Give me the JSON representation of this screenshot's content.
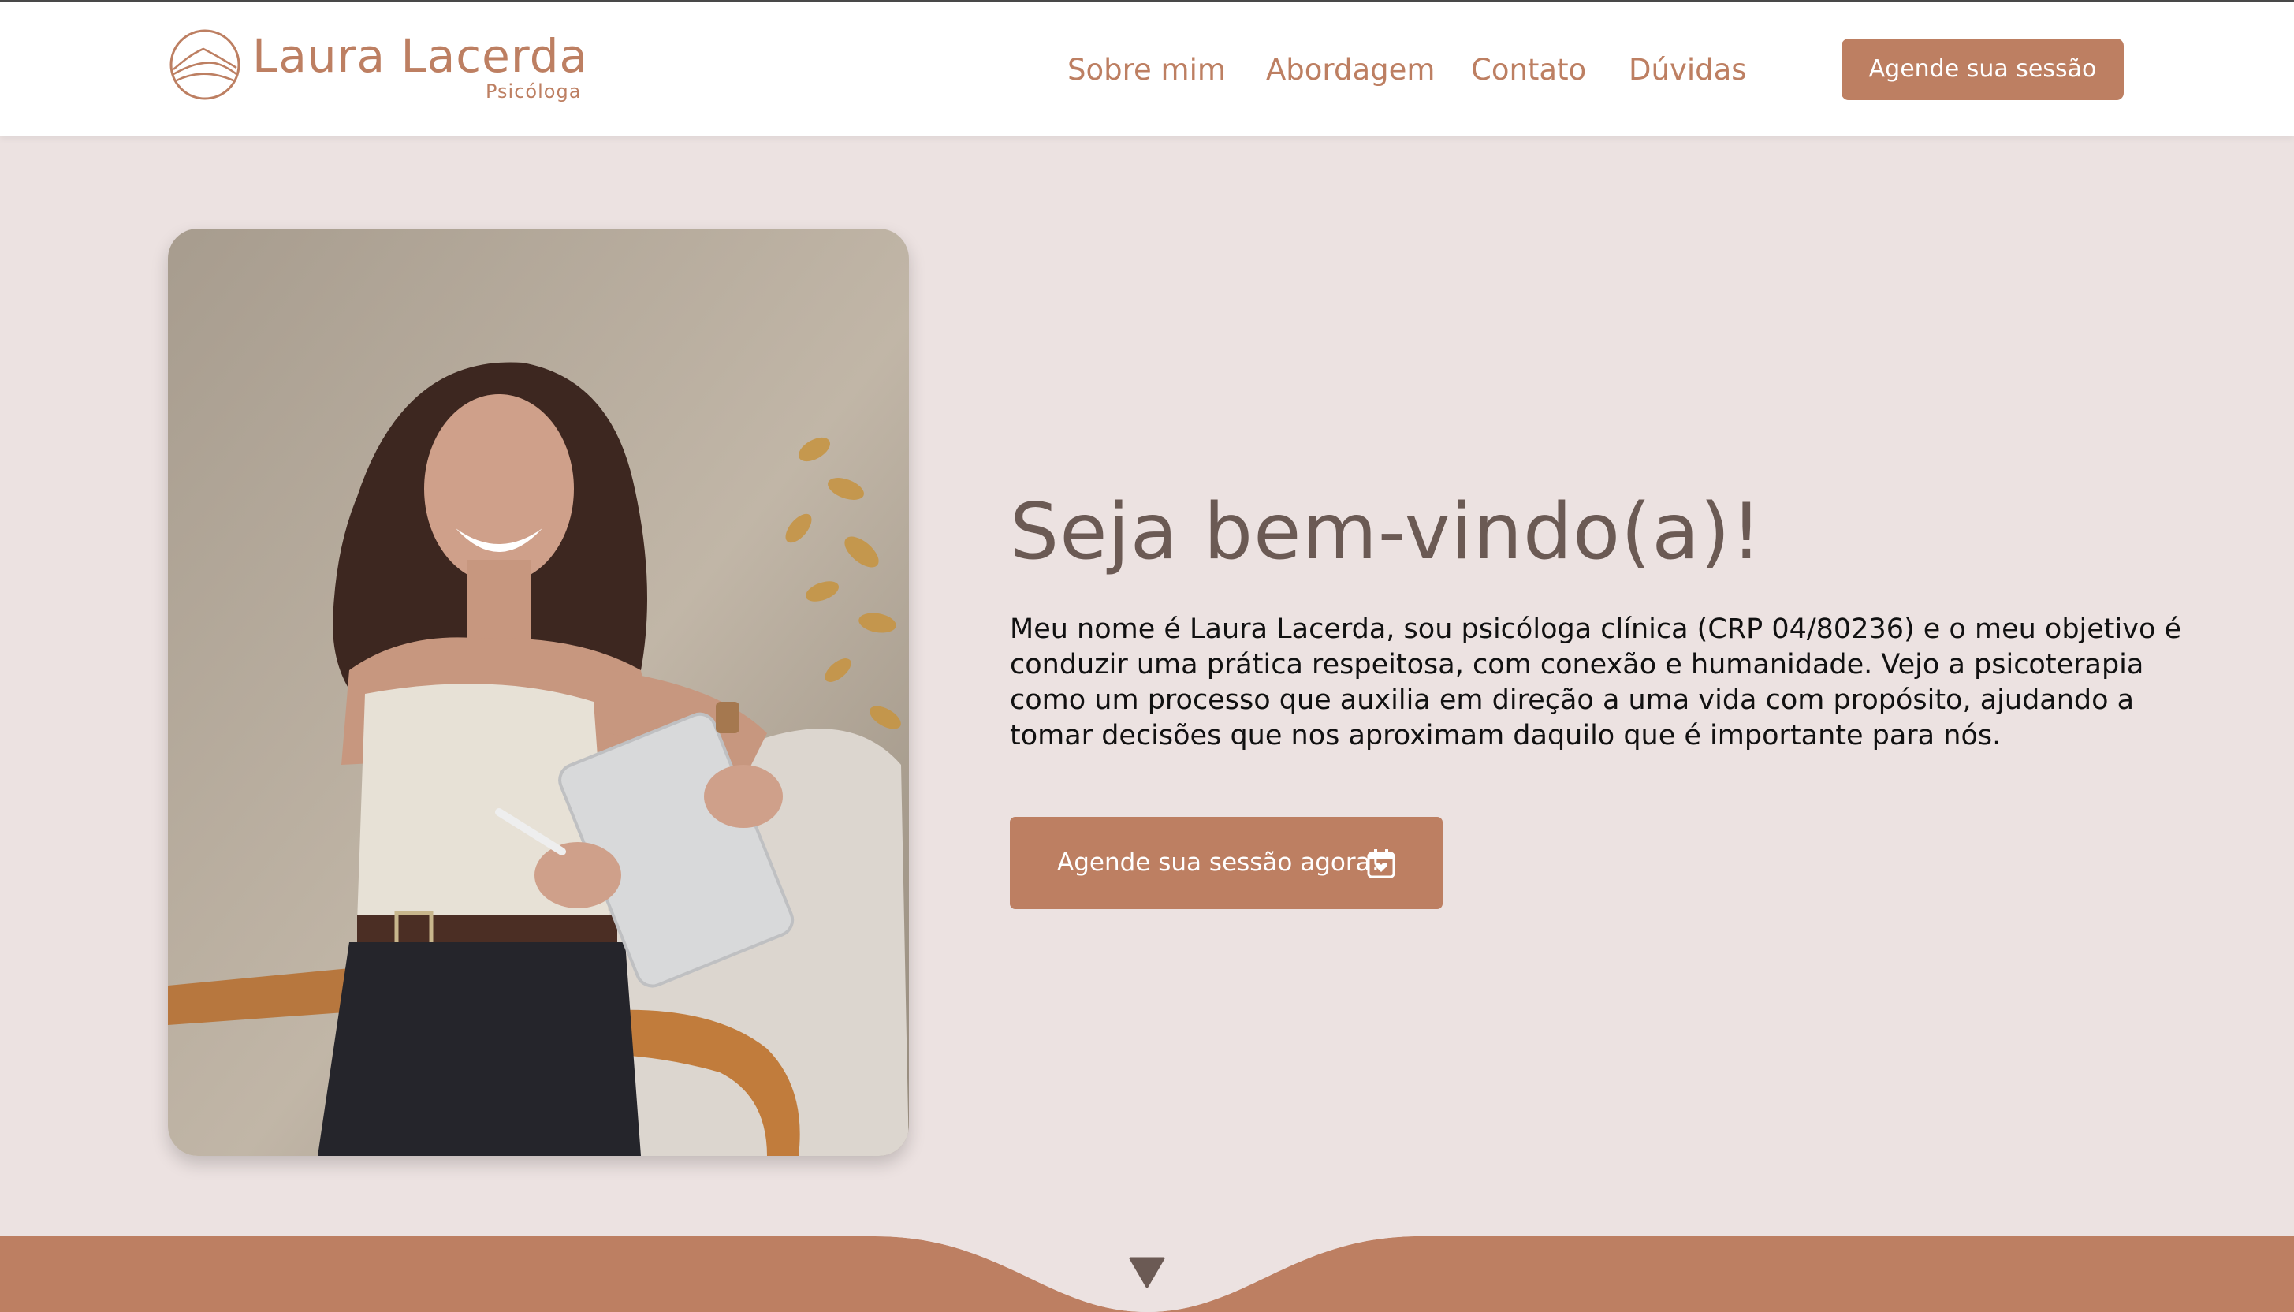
{
  "header": {
    "logo": {
      "name": "Laura Lacerda",
      "subtitle": "Psicóloga",
      "icon": "mountain-circle-logo"
    },
    "nav": [
      {
        "label": "Sobre mim"
      },
      {
        "label": "Abordagem"
      },
      {
        "label": "Contato"
      },
      {
        "label": "Dúvidas"
      }
    ],
    "cta_label": "Agende sua sessão"
  },
  "hero": {
    "title": "Seja bem-vindo(a)!",
    "text": "Meu nome é Laura Lacerda, sou psicóloga clínica (CRP 04/80236) e o meu objetivo é conduzir uma prática respeitosa, com conexão e humanidade. Vejo a psicoterapia como um processo que auxilia em direção a uma vida com propósito, ajudando a tomar decisões que nos aproximam daquilo que é importante para nós.",
    "cta_label": "Agende sua sessão agora!",
    "cta_icon": "calendar-heart-icon",
    "photo_alt": "Retrato de Laura Lacerda sentada em uma poltrona segurando um tablet"
  },
  "footer_wave": {
    "arrow_icon": "triangle-down-icon"
  },
  "colors": {
    "accent": "#bd7f62",
    "background": "#ece2e1",
    "title": "#6b5a54",
    "header_bg": "#ffffff",
    "text": "#111111"
  }
}
